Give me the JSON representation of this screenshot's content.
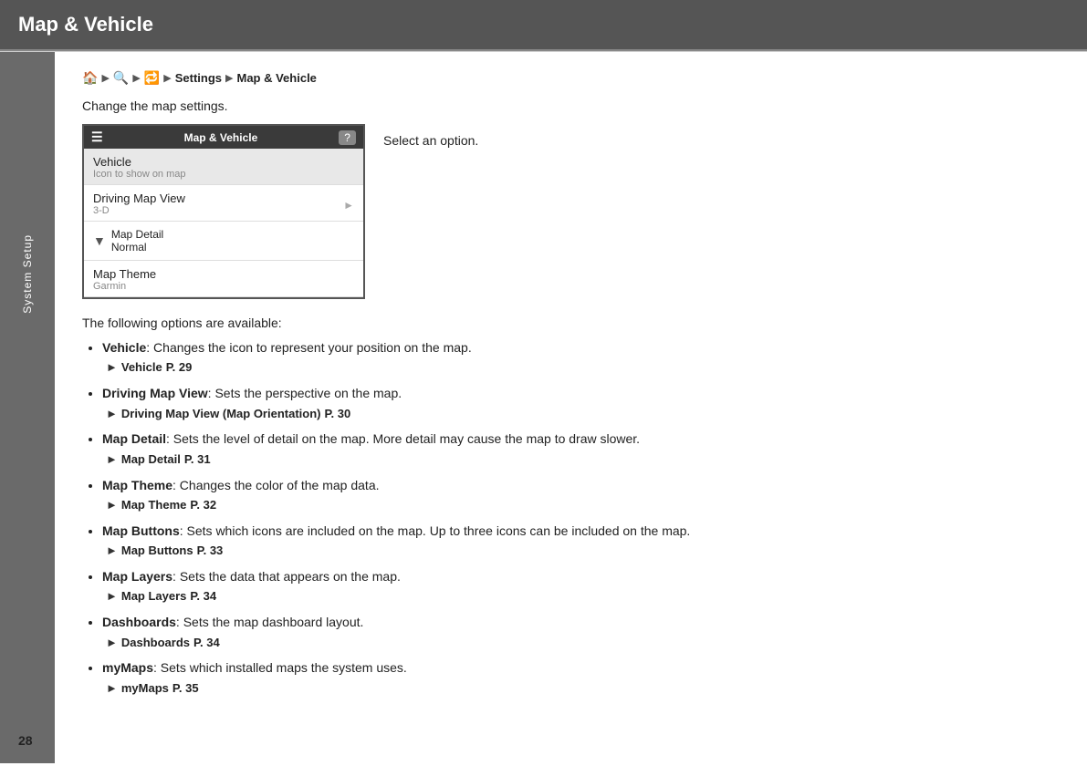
{
  "header": {
    "title": "Map & Vehicle"
  },
  "sidebar": {
    "label": "System Setup"
  },
  "breadcrumb": {
    "icons": [
      "🏠",
      "🔍",
      "🔁"
    ],
    "separator": "▶",
    "items": [
      "Settings",
      "Map & Vehicle"
    ]
  },
  "intro": "Change the map settings.",
  "screenshot_caption": "Select an option.",
  "device": {
    "header_title": "Map & Vehicle",
    "menu_items": [
      {
        "title": "Vehicle",
        "sub": "Icon to show on map",
        "type": "active"
      },
      {
        "title": "Driving Map View",
        "sub": "3-D",
        "type": "arrow"
      },
      {
        "title": "Map Detail",
        "sub": "Normal",
        "type": "down-arrow"
      },
      {
        "title": "Map Theme",
        "sub": "Garmin",
        "type": "normal"
      }
    ]
  },
  "options_intro": "The following options are available:",
  "options": [
    {
      "term": "Vehicle",
      "desc": ": Changes the icon to represent your position on the map.",
      "ref_label": "Vehicle",
      "ref_page": "P. 29"
    },
    {
      "term": "Driving Map View",
      "desc": ": Sets the perspective on the map.",
      "ref_label": "Driving Map View (Map Orientation)",
      "ref_page": "P. 30"
    },
    {
      "term": "Map Detail",
      "desc": ": Sets the level of detail on the map. More detail may cause the map to draw slower.",
      "ref_label": "Map Detail",
      "ref_page": "P. 31"
    },
    {
      "term": "Map Theme",
      "desc": ": Changes the color of the map data.",
      "ref_label": "Map Theme",
      "ref_page": "P. 32"
    },
    {
      "term": "Map Buttons",
      "desc": ": Sets which icons are included on the map. Up to three icons can be included on the map.",
      "ref_label": "Map Buttons",
      "ref_page": "P. 33"
    },
    {
      "term": "Map Layers",
      "desc": ": Sets the data that appears on the map.",
      "ref_label": "Map Layers",
      "ref_page": "P. 34"
    },
    {
      "term": "Dashboards",
      "desc": ": Sets the map dashboard layout.",
      "ref_label": "Dashboards",
      "ref_page": "P. 34"
    },
    {
      "term": "myMaps",
      "desc": ": Sets which installed maps the system uses.",
      "ref_label": "myMaps",
      "ref_page": "P. 35"
    }
  ],
  "page_number": "28"
}
